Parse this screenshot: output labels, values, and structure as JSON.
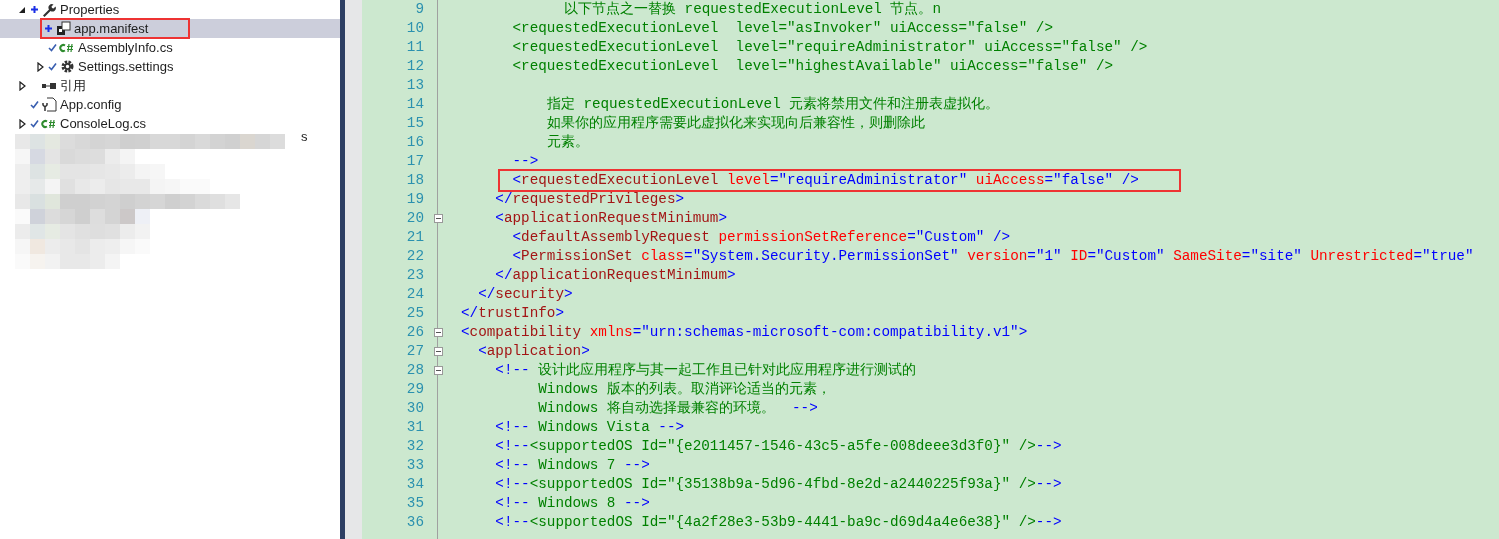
{
  "solution_tree": {
    "items": [
      {
        "label": "Properties",
        "kind": "wrench",
        "added": true,
        "checked_in": false,
        "expanded": true,
        "selected": false,
        "highlighted": false,
        "children": [
          {
            "label": "app.manifest",
            "kind": "manifest",
            "added": true,
            "checked_in": false,
            "selected": true,
            "highlighted": true
          },
          {
            "label": "AssemblyInfo.cs",
            "kind": "csharp",
            "added": false,
            "checked_in": true,
            "selected": false,
            "highlighted": false
          },
          {
            "label": "Settings.settings",
            "kind": "gear",
            "added": false,
            "checked_in": true,
            "expanded": false,
            "selected": false,
            "highlighted": false
          }
        ]
      },
      {
        "label": "引用",
        "kind": "reference",
        "added": false,
        "checked_in": false,
        "expanded": false,
        "selected": false,
        "highlighted": false
      },
      {
        "label": "App.config",
        "kind": "config",
        "added": false,
        "checked_in": true,
        "selected": false,
        "highlighted": false
      },
      {
        "label": "ConsoleLog.cs",
        "kind": "csharp",
        "added": false,
        "checked_in": true,
        "expanded": false,
        "selected": false,
        "highlighted": false
      }
    ],
    "blurred_suffix": "s"
  },
  "editor": {
    "lines": [
      {
        "number": "9",
        "foldable": false,
        "highlighted": false,
        "tokens": [
          {
            "kind": "comment",
            "text": "            以下节点之一替换 requestedExecutionLevel 节点。n"
          }
        ]
      },
      {
        "number": "10",
        "foldable": false,
        "highlighted": false,
        "tokens": [
          {
            "kind": "comment",
            "text": "      <requestedExecutionLevel  level=\"asInvoker\" uiAccess=\"false\" />"
          }
        ]
      },
      {
        "number": "11",
        "foldable": false,
        "highlighted": false,
        "tokens": [
          {
            "kind": "comment",
            "text": "      <requestedExecutionLevel  level=\"requireAdministrator\" uiAccess=\"false\" />"
          }
        ]
      },
      {
        "number": "12",
        "foldable": false,
        "highlighted": false,
        "tokens": [
          {
            "kind": "comment",
            "text": "      <requestedExecutionLevel  level=\"highestAvailable\" uiAccess=\"false\" />"
          }
        ]
      },
      {
        "number": "13",
        "foldable": false,
        "highlighted": false
      },
      {
        "number": "14",
        "foldable": false,
        "highlighted": false,
        "tokens": [
          {
            "kind": "comment",
            "text": "          指定 requestedExecutionLevel 元素将禁用文件和注册表虚拟化。"
          }
        ]
      },
      {
        "number": "15",
        "foldable": false,
        "highlighted": false,
        "tokens": [
          {
            "kind": "comment",
            "text": "          如果你的应用程序需要此虚拟化来实现向后兼容性，则删除此"
          }
        ]
      },
      {
        "number": "16",
        "foldable": false,
        "highlighted": false,
        "tokens": [
          {
            "kind": "comment",
            "text": "          元素。"
          }
        ]
      },
      {
        "number": "17",
        "foldable": false,
        "highlighted": false,
        "tokens": [
          {
            "kind": "bracket",
            "text": "      -->"
          }
        ]
      },
      {
        "number": "18",
        "foldable": false,
        "highlighted": true,
        "tokens": [
          {
            "kind": "bracket",
            "text": "      <"
          },
          {
            "kind": "tag",
            "text": "requestedExecutionLevel"
          },
          {
            "kind": "attr",
            "text": " level"
          },
          {
            "kind": "value",
            "text": "=\"requireAdministrator\""
          },
          {
            "kind": "attr",
            "text": " uiAccess"
          },
          {
            "kind": "value",
            "text": "=\"false\""
          },
          {
            "kind": "bracket",
            "text": " />"
          }
        ]
      },
      {
        "number": "19",
        "foldable": false,
        "highlighted": false,
        "tokens": [
          {
            "kind": "bracket",
            "text": "    </"
          },
          {
            "kind": "tag",
            "text": "requestedPrivileges"
          },
          {
            "kind": "bracket",
            "text": ">"
          }
        ]
      },
      {
        "number": "20",
        "foldable": true,
        "highlighted": false,
        "tokens": [
          {
            "kind": "bracket",
            "text": "    <"
          },
          {
            "kind": "tag",
            "text": "applicationRequestMinimum"
          },
          {
            "kind": "bracket",
            "text": ">"
          }
        ]
      },
      {
        "number": "21",
        "foldable": false,
        "highlighted": false,
        "tokens": [
          {
            "kind": "bracket",
            "text": "      <"
          },
          {
            "kind": "tag",
            "text": "defaultAssemblyRequest"
          },
          {
            "kind": "attr",
            "text": " permissionSetReference"
          },
          {
            "kind": "value",
            "text": "=\"Custom\""
          },
          {
            "kind": "bracket",
            "text": " />"
          }
        ]
      },
      {
        "number": "22",
        "foldable": false,
        "highlighted": false,
        "tokens": [
          {
            "kind": "bracket",
            "text": "      <"
          },
          {
            "kind": "tag",
            "text": "PermissionSet"
          },
          {
            "kind": "attr",
            "text": " class"
          },
          {
            "kind": "value",
            "text": "=\"System.Security.PermissionSet\""
          },
          {
            "kind": "attr",
            "text": " version"
          },
          {
            "kind": "value",
            "text": "=\"1\""
          },
          {
            "kind": "attr",
            "text": " ID"
          },
          {
            "kind": "value",
            "text": "=\"Custom\""
          },
          {
            "kind": "attr",
            "text": " SameSite"
          },
          {
            "kind": "value",
            "text": "=\"site\""
          },
          {
            "kind": "attr",
            "text": " Unrestricted"
          },
          {
            "kind": "value",
            "text": "=\"true\""
          }
        ]
      },
      {
        "number": "23",
        "foldable": false,
        "highlighted": false,
        "tokens": [
          {
            "kind": "bracket",
            "text": "    </"
          },
          {
            "kind": "tag",
            "text": "applicationRequestMinimum"
          },
          {
            "kind": "bracket",
            "text": ">"
          }
        ]
      },
      {
        "number": "24",
        "foldable": false,
        "highlighted": false,
        "tokens": [
          {
            "kind": "bracket",
            "text": "  </"
          },
          {
            "kind": "tag",
            "text": "security"
          },
          {
            "kind": "bracket",
            "text": ">"
          }
        ]
      },
      {
        "number": "25",
        "foldable": false,
        "highlighted": false,
        "tokens": [
          {
            "kind": "bracket",
            "text": "</"
          },
          {
            "kind": "tag",
            "text": "trustInfo"
          },
          {
            "kind": "bracket",
            "text": ">"
          }
        ]
      },
      {
        "number": "26",
        "foldable": true,
        "highlighted": false,
        "tokens": [
          {
            "kind": "bracket",
            "text": "<"
          },
          {
            "kind": "tag",
            "text": "compatibility"
          },
          {
            "kind": "attr",
            "text": " xmlns"
          },
          {
            "kind": "value",
            "text": "=\"urn:schemas-microsoft-com:compatibility.v1\""
          },
          {
            "kind": "bracket",
            "text": ">"
          }
        ]
      },
      {
        "number": "27",
        "foldable": true,
        "highlighted": false,
        "tokens": [
          {
            "kind": "bracket",
            "text": "  <"
          },
          {
            "kind": "tag",
            "text": "application"
          },
          {
            "kind": "bracket",
            "text": ">"
          }
        ]
      },
      {
        "number": "28",
        "foldable": true,
        "highlighted": false,
        "tokens": [
          {
            "kind": "bracket",
            "text": "    <!--"
          },
          {
            "kind": "comment",
            "text": " 设计此应用程序与其一起工作且已针对此应用程序进行测试的"
          }
        ]
      },
      {
        "number": "29",
        "foldable": false,
        "highlighted": false,
        "tokens": [
          {
            "kind": "comment",
            "text": "         Windows 版本的列表。取消评论适当的元素，"
          }
        ]
      },
      {
        "number": "30",
        "foldable": false,
        "highlighted": false,
        "tokens": [
          {
            "kind": "comment",
            "text": "         Windows 将自动选择最兼容的环境。"
          },
          {
            "kind": "bracket",
            "text": "  -->"
          }
        ]
      },
      {
        "number": "31",
        "foldable": false,
        "highlighted": false,
        "tokens": [
          {
            "kind": "bracket",
            "text": "    <!--"
          },
          {
            "kind": "comment",
            "text": " Windows Vista "
          },
          {
            "kind": "bracket",
            "text": "-->"
          }
        ]
      },
      {
        "number": "32",
        "foldable": false,
        "highlighted": false,
        "tokens": [
          {
            "kind": "bracket",
            "text": "    <!--"
          },
          {
            "kind": "comment",
            "text": "<supportedOS Id=\"{e2011457-1546-43c5-a5fe-008deee3d3f0}\" />"
          },
          {
            "kind": "bracket",
            "text": "-->"
          }
        ]
      },
      {
        "number": "33",
        "foldable": false,
        "highlighted": false,
        "tokens": [
          {
            "kind": "bracket",
            "text": "    <!--"
          },
          {
            "kind": "comment",
            "text": " Windows 7 "
          },
          {
            "kind": "bracket",
            "text": "-->"
          }
        ]
      },
      {
        "number": "34",
        "foldable": false,
        "highlighted": false,
        "tokens": [
          {
            "kind": "bracket",
            "text": "    <!--"
          },
          {
            "kind": "comment",
            "text": "<supportedOS Id=\"{35138b9a-5d96-4fbd-8e2d-a2440225f93a}\" />"
          },
          {
            "kind": "bracket",
            "text": "-->"
          }
        ]
      },
      {
        "number": "35",
        "foldable": false,
        "highlighted": false,
        "tokens": [
          {
            "kind": "bracket",
            "text": "    <!--"
          },
          {
            "kind": "comment",
            "text": " Windows 8 "
          },
          {
            "kind": "bracket",
            "text": "-->"
          }
        ]
      },
      {
        "number": "36",
        "foldable": false,
        "highlighted": false,
        "tokens": [
          {
            "kind": "bracket",
            "text": "    <!--"
          },
          {
            "kind": "comment",
            "text": "<supportedOS Id=\"{4a2f28e3-53b9-4441-ba9c-d69d4a4e6e38}\" />"
          },
          {
            "kind": "bracket",
            "text": "-->"
          }
        ]
      }
    ]
  }
}
